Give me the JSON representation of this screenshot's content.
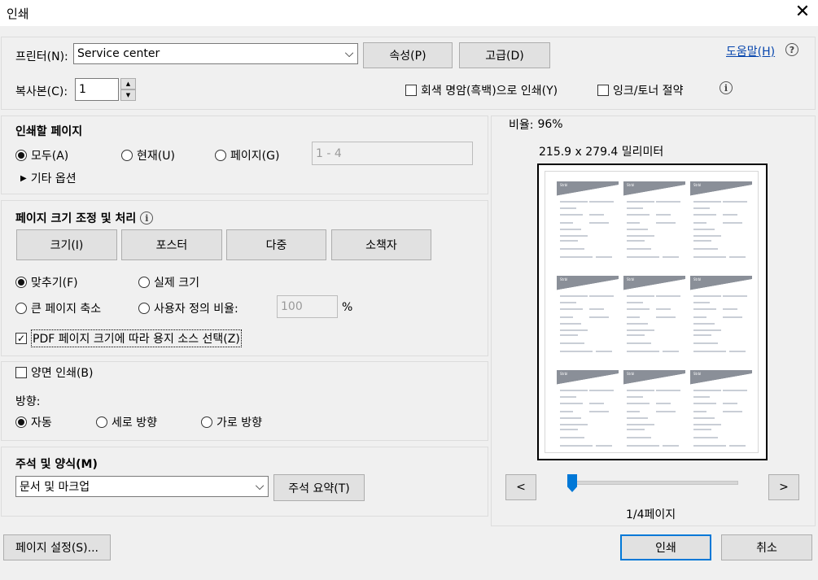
{
  "window": {
    "title": "인쇄",
    "close_symbol": "✕"
  },
  "printer": {
    "label": "프린터(N):",
    "selected": "Service center",
    "properties_button": "속성(P)",
    "advanced_button": "고급(D)",
    "help_link": "도움말(H)",
    "help_symbol": "?"
  },
  "copies": {
    "label": "복사본(C):",
    "value": "1",
    "grayscale_label": "회색 명암(흑백)으로 인쇄(Y)",
    "grayscale_checked": false,
    "save_ink_label": "잉크/토너 절약",
    "save_ink_checked": false
  },
  "pages_to_print": {
    "heading": "인쇄할 페이지",
    "all": "모두(A)",
    "current": "현재(U)",
    "pages": "페이지(G)",
    "pages_range": "1 - 4",
    "selected": "all",
    "more_options": "기타 옵션",
    "expand_symbol": "▶"
  },
  "sizing": {
    "heading": "페이지 크기 조정 및 처리",
    "tabs": [
      "크기(I)",
      "포스터",
      "다중",
      "소책자"
    ],
    "fit": "맞추기(F)",
    "actual_size": "실제 크기",
    "shrink_oversized": "큰 페이지 축소",
    "custom_scale": "사용자 정의 비율:",
    "custom_scale_value": "100",
    "percent": "%",
    "selected": "fit",
    "choose_source": "PDF 페이지 크기에 따라 용지 소스 선택(Z)",
    "choose_source_checked": true
  },
  "duplex": {
    "label": "양면 인쇄(B)",
    "checked": false
  },
  "orientation": {
    "label": "방향:",
    "auto": "자동",
    "portrait": "세로 방향",
    "landscape": "가로 방향",
    "selected": "auto"
  },
  "comments": {
    "heading": "주석 및 양식(M)",
    "selected": "문서 및 마크업",
    "summarize_button": "주석 요약(T)"
  },
  "preview": {
    "scale_label": "비율:",
    "scale_value": "96%",
    "paper_size": "215.9 x 279.4 밀리미터",
    "prev_button": "<",
    "next_button": ">",
    "page_indicator": "1/4페이지",
    "page_position": 0.0,
    "thumbnail_caption": "Strbl"
  },
  "footer": {
    "page_setup_button": "페이지 설정(S)...",
    "print_button": "인쇄",
    "cancel_button": "취소"
  },
  "icons": {
    "info": "i",
    "chevron_down": "⌵",
    "spin_up": "▲",
    "spin_down": "▼",
    "check_mark": "✓"
  },
  "colors": {
    "accent": "#0078d7",
    "link": "#0645ad"
  }
}
